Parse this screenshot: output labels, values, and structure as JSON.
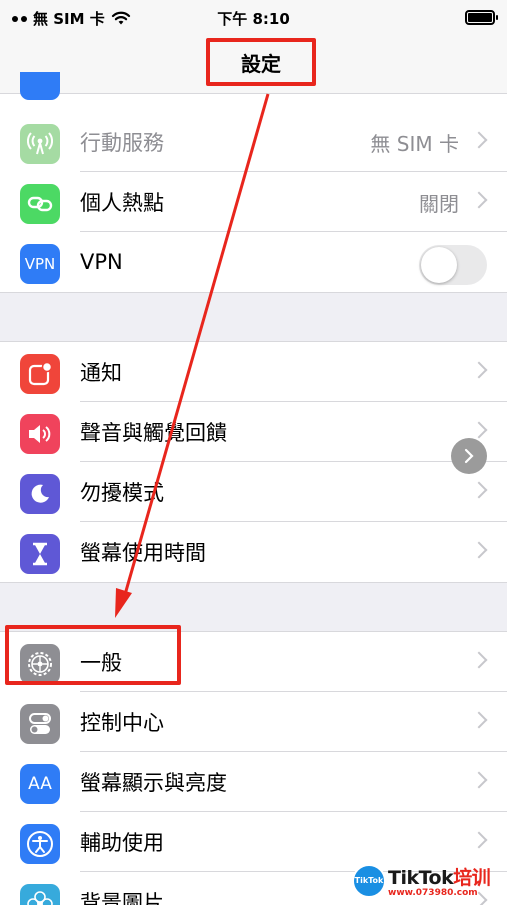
{
  "status_bar": {
    "carrier": "無 SIM 卡",
    "time": "下午 8:10"
  },
  "nav": {
    "title": "設定"
  },
  "sections": [
    {
      "rows": [
        {
          "label": "行動服務",
          "value": "無 SIM 卡",
          "icon": "antenna-icon",
          "color": "#a5dba3",
          "label_color": "#8e8e93"
        },
        {
          "label": "個人熱點",
          "value": "關閉",
          "icon": "link-icon",
          "color": "#4cd964"
        },
        {
          "label": "VPN",
          "icon": "vpn-icon",
          "icon_text": "VPN",
          "color": "#2f7cf6",
          "toggle": false
        }
      ]
    },
    {
      "rows": [
        {
          "label": "通知",
          "icon": "notification-icon",
          "color": "#f0453a"
        },
        {
          "label": "聲音與觸覺回饋",
          "icon": "speaker-icon",
          "color": "#f0435c"
        },
        {
          "label": "勿擾模式",
          "icon": "moon-icon",
          "color": "#5f58d6"
        },
        {
          "label": "螢幕使用時間",
          "icon": "hourglass-icon",
          "color": "#5f58d6"
        }
      ]
    },
    {
      "rows": [
        {
          "label": "一般",
          "icon": "gear-icon",
          "color": "#8e8e93"
        },
        {
          "label": "控制中心",
          "icon": "toggles-icon",
          "color": "#8e8e93"
        },
        {
          "label": "螢幕顯示與亮度",
          "icon": "text-size-icon",
          "icon_text": "AA",
          "color": "#2f7cf6"
        },
        {
          "label": "輔助使用",
          "icon": "accessibility-icon",
          "color": "#2f7cf6"
        },
        {
          "label": "背景圖片",
          "icon": "flower-icon",
          "color": "#37aadc"
        }
      ]
    }
  ],
  "watermark": {
    "badge": "TikTok",
    "brand": "TikTok",
    "brand_cn": "培训",
    "url": "www.073980.com"
  },
  "colors": {
    "annotation_red": "#e8261d",
    "chevron": "#c7c7cc",
    "secondary_text": "#8e8e93"
  }
}
